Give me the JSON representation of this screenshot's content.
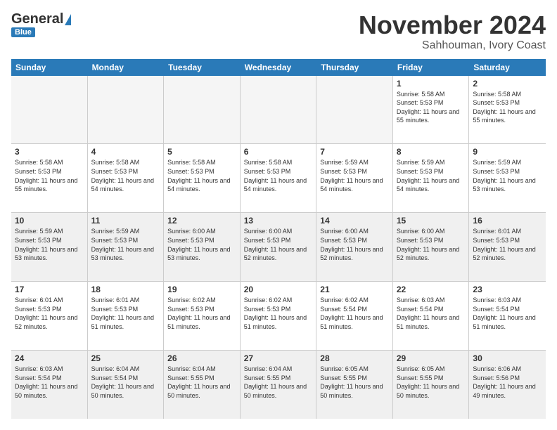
{
  "logo": {
    "line1": "General",
    "line2": "Blue"
  },
  "title": "November 2024",
  "location": "Sahhouman, Ivory Coast",
  "days": [
    "Sunday",
    "Monday",
    "Tuesday",
    "Wednesday",
    "Thursday",
    "Friday",
    "Saturday"
  ],
  "rows": [
    [
      {
        "day": "",
        "empty": true
      },
      {
        "day": "",
        "empty": true
      },
      {
        "day": "",
        "empty": true
      },
      {
        "day": "",
        "empty": true
      },
      {
        "day": "",
        "empty": true
      },
      {
        "day": "1",
        "sunrise": "5:58 AM",
        "sunset": "5:53 PM",
        "daylight": "11 hours and 55 minutes."
      },
      {
        "day": "2",
        "sunrise": "5:58 AM",
        "sunset": "5:53 PM",
        "daylight": "11 hours and 55 minutes."
      }
    ],
    [
      {
        "day": "3",
        "sunrise": "5:58 AM",
        "sunset": "5:53 PM",
        "daylight": "11 hours and 55 minutes."
      },
      {
        "day": "4",
        "sunrise": "5:58 AM",
        "sunset": "5:53 PM",
        "daylight": "11 hours and 54 minutes."
      },
      {
        "day": "5",
        "sunrise": "5:58 AM",
        "sunset": "5:53 PM",
        "daylight": "11 hours and 54 minutes."
      },
      {
        "day": "6",
        "sunrise": "5:58 AM",
        "sunset": "5:53 PM",
        "daylight": "11 hours and 54 minutes."
      },
      {
        "day": "7",
        "sunrise": "5:59 AM",
        "sunset": "5:53 PM",
        "daylight": "11 hours and 54 minutes."
      },
      {
        "day": "8",
        "sunrise": "5:59 AM",
        "sunset": "5:53 PM",
        "daylight": "11 hours and 54 minutes."
      },
      {
        "day": "9",
        "sunrise": "5:59 AM",
        "sunset": "5:53 PM",
        "daylight": "11 hours and 53 minutes."
      }
    ],
    [
      {
        "day": "10",
        "sunrise": "5:59 AM",
        "sunset": "5:53 PM",
        "daylight": "11 hours and 53 minutes."
      },
      {
        "day": "11",
        "sunrise": "5:59 AM",
        "sunset": "5:53 PM",
        "daylight": "11 hours and 53 minutes."
      },
      {
        "day": "12",
        "sunrise": "6:00 AM",
        "sunset": "5:53 PM",
        "daylight": "11 hours and 53 minutes."
      },
      {
        "day": "13",
        "sunrise": "6:00 AM",
        "sunset": "5:53 PM",
        "daylight": "11 hours and 52 minutes."
      },
      {
        "day": "14",
        "sunrise": "6:00 AM",
        "sunset": "5:53 PM",
        "daylight": "11 hours and 52 minutes."
      },
      {
        "day": "15",
        "sunrise": "6:00 AM",
        "sunset": "5:53 PM",
        "daylight": "11 hours and 52 minutes."
      },
      {
        "day": "16",
        "sunrise": "6:01 AM",
        "sunset": "5:53 PM",
        "daylight": "11 hours and 52 minutes."
      }
    ],
    [
      {
        "day": "17",
        "sunrise": "6:01 AM",
        "sunset": "5:53 PM",
        "daylight": "11 hours and 52 minutes."
      },
      {
        "day": "18",
        "sunrise": "6:01 AM",
        "sunset": "5:53 PM",
        "daylight": "11 hours and 51 minutes."
      },
      {
        "day": "19",
        "sunrise": "6:02 AM",
        "sunset": "5:53 PM",
        "daylight": "11 hours and 51 minutes."
      },
      {
        "day": "20",
        "sunrise": "6:02 AM",
        "sunset": "5:53 PM",
        "daylight": "11 hours and 51 minutes."
      },
      {
        "day": "21",
        "sunrise": "6:02 AM",
        "sunset": "5:54 PM",
        "daylight": "11 hours and 51 minutes."
      },
      {
        "day": "22",
        "sunrise": "6:03 AM",
        "sunset": "5:54 PM",
        "daylight": "11 hours and 51 minutes."
      },
      {
        "day": "23",
        "sunrise": "6:03 AM",
        "sunset": "5:54 PM",
        "daylight": "11 hours and 51 minutes."
      }
    ],
    [
      {
        "day": "24",
        "sunrise": "6:03 AM",
        "sunset": "5:54 PM",
        "daylight": "11 hours and 50 minutes."
      },
      {
        "day": "25",
        "sunrise": "6:04 AM",
        "sunset": "5:54 PM",
        "daylight": "11 hours and 50 minutes."
      },
      {
        "day": "26",
        "sunrise": "6:04 AM",
        "sunset": "5:55 PM",
        "daylight": "11 hours and 50 minutes."
      },
      {
        "day": "27",
        "sunrise": "6:04 AM",
        "sunset": "5:55 PM",
        "daylight": "11 hours and 50 minutes."
      },
      {
        "day": "28",
        "sunrise": "6:05 AM",
        "sunset": "5:55 PM",
        "daylight": "11 hours and 50 minutes."
      },
      {
        "day": "29",
        "sunrise": "6:05 AM",
        "sunset": "5:55 PM",
        "daylight": "11 hours and 50 minutes."
      },
      {
        "day": "30",
        "sunrise": "6:06 AM",
        "sunset": "5:56 PM",
        "daylight": "11 hours and 49 minutes."
      }
    ]
  ]
}
